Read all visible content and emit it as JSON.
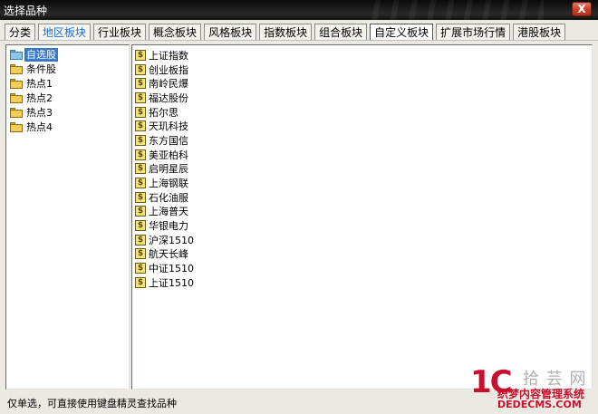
{
  "window": {
    "title": "选择品种",
    "close_label": "X"
  },
  "tabs": [
    {
      "label": "分类"
    },
    {
      "label": "地区板块"
    },
    {
      "label": "行业板块"
    },
    {
      "label": "概念板块"
    },
    {
      "label": "风格板块"
    },
    {
      "label": "指数板块"
    },
    {
      "label": "组合板块"
    },
    {
      "label": "自定义板块"
    },
    {
      "label": "扩展市场行情"
    },
    {
      "label": "港股板块"
    }
  ],
  "colors": {
    "active_tab_text": "#1e6fd0",
    "selection": "#3877c3",
    "titlebar": "#1a1a1a"
  },
  "tree": {
    "items": [
      {
        "label": "自选股",
        "icon": "folder-open-icon"
      },
      {
        "label": "条件股",
        "icon": "folder-icon"
      },
      {
        "label": "热点1",
        "icon": "folder-icon"
      },
      {
        "label": "热点2",
        "icon": "folder-icon"
      },
      {
        "label": "热点3",
        "icon": "folder-icon"
      },
      {
        "label": "热点4",
        "icon": "folder-icon"
      }
    ]
  },
  "stocks": {
    "icon_glyph": "$",
    "items": [
      {
        "label": "上证指数"
      },
      {
        "label": "创业板指"
      },
      {
        "label": "南岭民爆"
      },
      {
        "label": "福达股份"
      },
      {
        "label": "拓尔思"
      },
      {
        "label": "天玑科技"
      },
      {
        "label": "东方国信"
      },
      {
        "label": "美亚柏科"
      },
      {
        "label": "启明星辰"
      },
      {
        "label": "上海钢联"
      },
      {
        "label": "石化油服"
      },
      {
        "label": "上海普天"
      },
      {
        "label": "华银电力"
      },
      {
        "label": "沪深1510"
      },
      {
        "label": "航天长峰"
      },
      {
        "label": "中证1510"
      },
      {
        "label": "上证1510"
      }
    ]
  },
  "status": {
    "text": "仅单选，可直接使用键盘精灵查找品种"
  },
  "watermark": {
    "big": "1C",
    "cn": "拾 芸 网",
    "line1": "织梦内容管理系统",
    "line2": "DEDECMS.COM"
  }
}
